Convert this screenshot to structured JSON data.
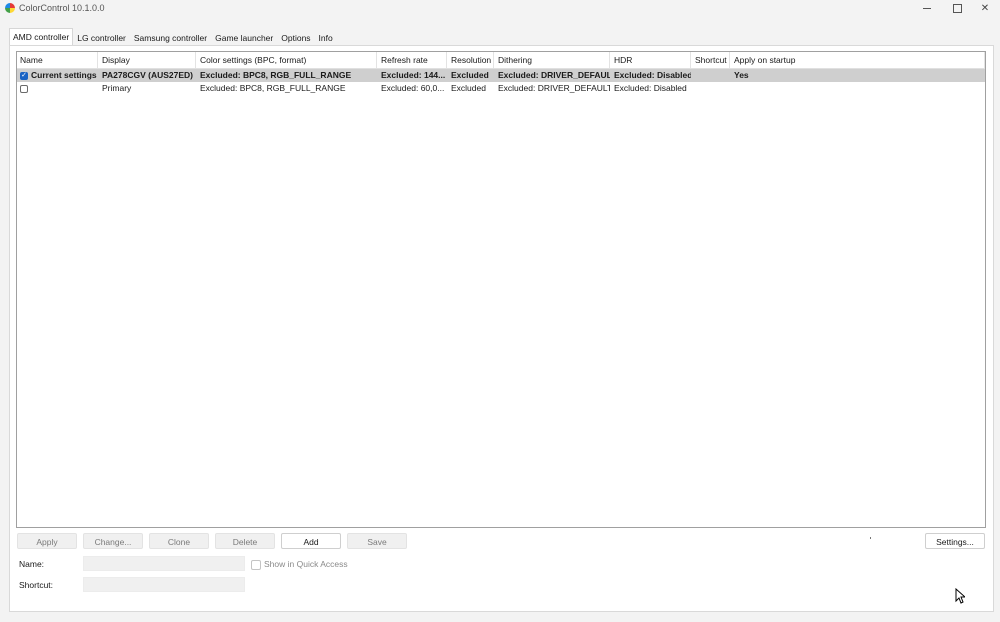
{
  "window": {
    "title": "ColorControl 10.1.0.0"
  },
  "tabs": [
    {
      "label": "AMD controller",
      "active": true
    },
    {
      "label": "LG controller"
    },
    {
      "label": "Samsung controller"
    },
    {
      "label": "Game launcher"
    },
    {
      "label": "Options"
    },
    {
      "label": "Info"
    }
  ],
  "grid": {
    "columns": [
      "Name",
      "Display",
      "Color settings (BPC, format)",
      "Refresh rate",
      "Resolution",
      "Dithering",
      "HDR",
      "Shortcut",
      "Apply on startup"
    ],
    "rows": [
      {
        "checked": true,
        "selected": true,
        "name": "Current settings",
        "display": "PA278CGV (AUS27ED)",
        "color": "Excluded: BPC8, RGB_FULL_RANGE",
        "refresh": "Excluded: 144...",
        "resolution": "Excluded",
        "dithering": "Excluded: DRIVER_DEFAULT",
        "hdr": "Excluded: Disabled",
        "shortcut": "",
        "startup": "Yes"
      },
      {
        "checked": false,
        "selected": false,
        "name": "",
        "display": "Primary",
        "color": "Excluded: BPC8, RGB_FULL_RANGE",
        "refresh": "Excluded: 60,0...",
        "resolution": "Excluded",
        "dithering": "Excluded: DRIVER_DEFAULT",
        "hdr": "Excluded: Disabled",
        "shortcut": "",
        "startup": ""
      }
    ]
  },
  "buttons": {
    "apply": "Apply",
    "change": "Change...",
    "clone": "Clone",
    "delete": "Delete",
    "add": "Add",
    "save": "Save",
    "settings": "Settings..."
  },
  "form": {
    "name_label": "Name:",
    "name_value": "",
    "quick_access_label": "Show in Quick Access",
    "quick_access_checked": false,
    "shortcut_label": "Shortcut:",
    "shortcut_value": ""
  },
  "colors": {
    "accent": "#1a63c4",
    "selected_row": "#cfcfcf"
  }
}
